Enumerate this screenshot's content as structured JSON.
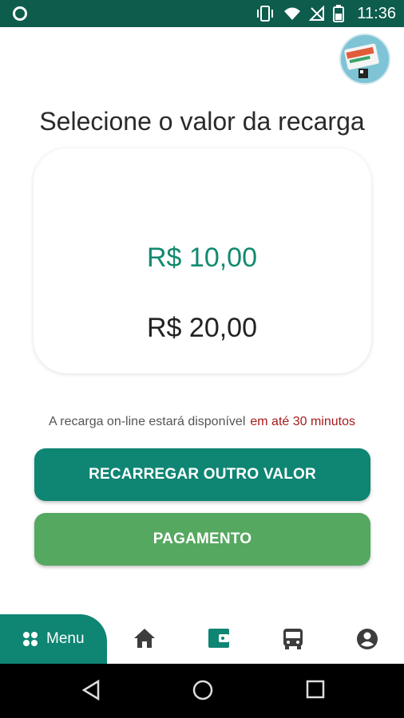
{
  "status_bar": {
    "time": "11:36"
  },
  "page": {
    "title": "Selecione o valor da recarga"
  },
  "values": [
    {
      "label": "R$ 10,00",
      "selected": true
    },
    {
      "label": "R$ 20,00",
      "selected": false
    }
  ],
  "info": {
    "text": "A recarga on-line estará disponível",
    "highlight": "em até 30 minutos"
  },
  "buttons": {
    "other_value": "RECARREGAR OUTRO VALOR",
    "payment": "PAGAMENTO"
  },
  "bottom_nav": {
    "menu_label": "Menu",
    "icons": [
      "home-icon",
      "wallet-icon",
      "bus-icon",
      "account-icon"
    ]
  },
  "colors": {
    "primary": "#0f8573",
    "payment": "#55a860",
    "selected_value": "#128a6f",
    "highlight": "#a61c1c",
    "status_bar": "#0d5c4c"
  }
}
